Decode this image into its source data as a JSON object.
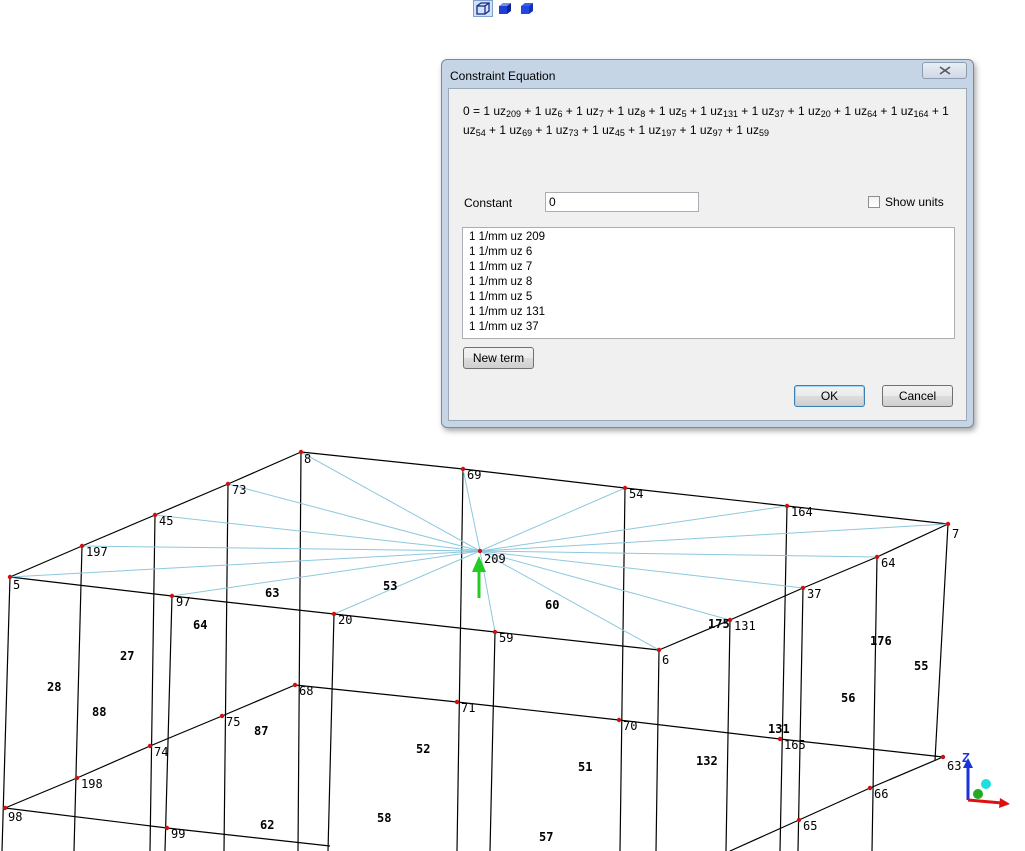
{
  "toolbar": {
    "icons": [
      "view-wireframe-icon",
      "view-shaded-icon",
      "view-solid-icon"
    ]
  },
  "dialog": {
    "title": "Constraint Equation",
    "equation": {
      "prefix": "0 = ",
      "terms": [
        {
          "coef": "1",
          "var": "uz",
          "node": "209"
        },
        {
          "coef": "1",
          "var": "uz",
          "node": "6"
        },
        {
          "coef": "1",
          "var": "uz",
          "node": "7"
        },
        {
          "coef": "1",
          "var": "uz",
          "node": "8"
        },
        {
          "coef": "1",
          "var": "uz",
          "node": "5"
        },
        {
          "coef": "1",
          "var": "uz",
          "node": "131"
        },
        {
          "coef": "1",
          "var": "uz",
          "node": "37"
        },
        {
          "coef": "1",
          "var": "uz",
          "node": "20"
        },
        {
          "coef": "1",
          "var": "uz",
          "node": "64"
        },
        {
          "coef": "1",
          "var": "uz",
          "node": "164"
        },
        {
          "coef": "1",
          "var": "uz",
          "node": "54"
        },
        {
          "coef": "1",
          "var": "uz",
          "node": "69"
        },
        {
          "coef": "1",
          "var": "uz",
          "node": "73"
        },
        {
          "coef": "1",
          "var": "uz",
          "node": "45"
        },
        {
          "coef": "1",
          "var": "uz",
          "node": "197"
        },
        {
          "coef": "1",
          "var": "uz",
          "node": "97"
        },
        {
          "coef": "1",
          "var": "uz",
          "node": "59"
        }
      ]
    },
    "constant_label": "Constant",
    "constant_value": "0",
    "show_units_label": "Show units",
    "show_units_checked": false,
    "terms_list": [
      "1 1/mm uz 209",
      "1 1/mm uz 6",
      "1 1/mm uz 7",
      "1 1/mm uz 8",
      "1 1/mm uz 5",
      "1 1/mm uz 131",
      "1 1/mm uz 37"
    ],
    "new_term_label": "New term",
    "ok_label": "OK",
    "cancel_label": "Cancel"
  },
  "model": {
    "node_color": "#cc1111",
    "edge_color": "#000000",
    "spider_color": "#8ec8de",
    "arrow_color": "#22cc22",
    "node_labels": [
      "8",
      "69",
      "54",
      "164",
      "7",
      "73",
      "45",
      "197",
      "5",
      "97",
      "20",
      "59",
      "6",
      "131",
      "37",
      "64",
      "209",
      "68",
      "71",
      "70",
      "165",
      "63",
      "75",
      "74",
      "198",
      "98",
      "99",
      "66",
      "65"
    ],
    "element_labels": [
      "53",
      "63",
      "64",
      "60",
      "175",
      "176",
      "55",
      "56",
      "27",
      "28",
      "88",
      "87",
      "52",
      "51",
      "132",
      "131",
      "62",
      "58",
      "57"
    ],
    "triad": {
      "z": "Z",
      "x_color": "#dd1111",
      "y_color": "#22aa22",
      "z_color": "#1a33dd"
    }
  }
}
